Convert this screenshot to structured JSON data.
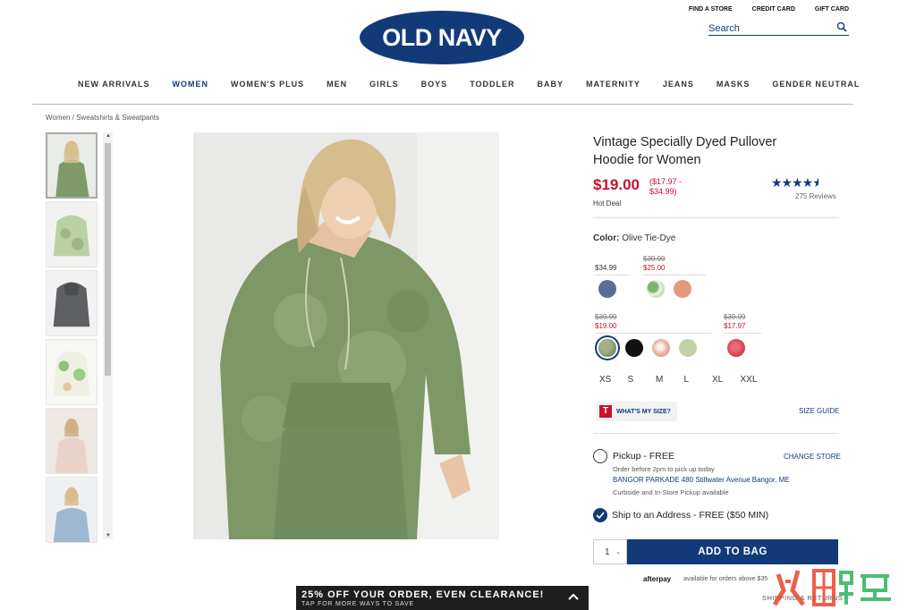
{
  "header": {
    "logo_text": "OLD NAVY",
    "util_links": [
      "FIND A STORE",
      "CREDIT CARD",
      "GIFT CARD"
    ],
    "search_placeholder": "Search"
  },
  "nav": {
    "items": [
      "NEW ARRIVALS",
      "WOMEN",
      "WOMEN'S PLUS",
      "MEN",
      "GIRLS",
      "BOYS",
      "TODDLER",
      "BABY",
      "MATERNITY",
      "JEANS",
      "MASKS",
      "GENDER NEUTRAL"
    ],
    "active": "WOMEN"
  },
  "breadcrumb": "Women / Sweatshirts & Sweatpants",
  "product": {
    "title": "Vintage Specially Dyed Pullover Hoodie for Women",
    "price": "$19.00",
    "price_range": "($17.97 - $34.99)",
    "deal_label": "Hot Deal",
    "rating": 4.5,
    "stars": "★★★★",
    "reviews": "275 Reviews",
    "color_label": "Color:",
    "color_value": "Olive Tie-Dye"
  },
  "price_groups": {
    "g1": {
      "regular": "$34.99"
    },
    "g2": {
      "old": "$39.99",
      "new": "$25.00"
    },
    "g3": {
      "old": "$39.99",
      "new": "$19.00"
    },
    "g4": {
      "old": "$39.99",
      "new": "$17.97"
    }
  },
  "swatch_colors": {
    "navy": "#5a6e94",
    "tiedye_green": "#9bbf88",
    "peach": "#e49a7a",
    "olive": "#8a9a72",
    "black": "#111111",
    "pink_tiedye": "#e6b4a6",
    "sage": "#c3d2a6",
    "red": "#d03a4a"
  },
  "sizes": [
    "XS",
    "S",
    "M",
    "L",
    "XL",
    "XXL"
  ],
  "fit": {
    "wims_icon": "T",
    "wims_label": "WHAT'S MY SIZE?",
    "size_guide": "SIZE GUIDE"
  },
  "fulfillment": {
    "pickup_label": "Pickup - FREE",
    "change_store": "CHANGE STORE",
    "pickup_note": "Order before 2pm to pick up today",
    "store": "BANGOR PARKADE 480 Stillwater Avenue  Bangor, ME",
    "store_note": "Curbside and In-Store Pickup available",
    "ship_label": "Ship to an Address - FREE ($50 MIN)"
  },
  "cart": {
    "qty": "1",
    "add_label": "ADD TO BAG"
  },
  "afterpay": {
    "brand": "afterpay",
    "note": "available for orders above $35"
  },
  "shipping_returns": "SHIPPING & RETURNS",
  "promo": {
    "headline": "25% OFF YOUR ORDER, EVEN CLEARANCE!",
    "sub": "TAP FOR MORE WAYS TO SAVE"
  },
  "colors": {
    "brand_navy": "#123a78",
    "sale_red": "#c8102e"
  }
}
